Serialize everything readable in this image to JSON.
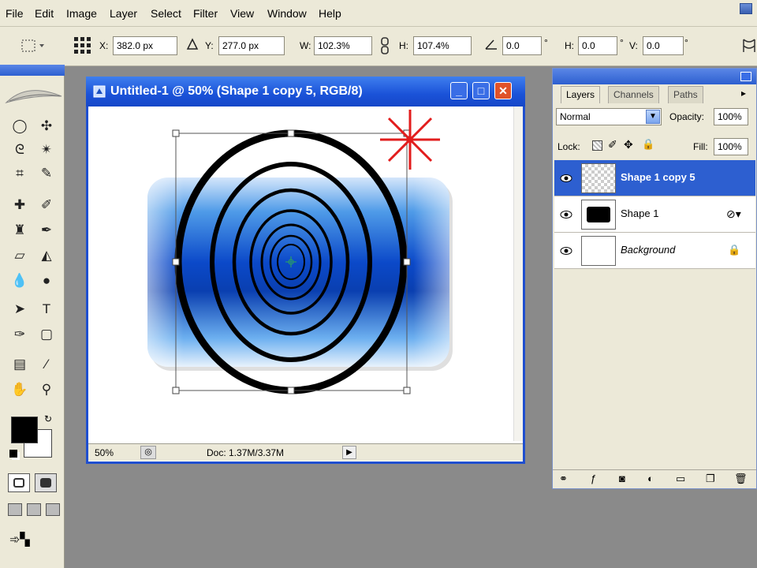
{
  "menu": [
    "File",
    "Edit",
    "Image",
    "Layer",
    "Select",
    "Filter",
    "View",
    "Window",
    "Help"
  ],
  "options": {
    "x_label": "X:",
    "x_value": "382.0 px",
    "y_label": "Y:",
    "y_value": "277.0 px",
    "w_label": "W:",
    "w_value": "102.3%",
    "h_label": "H:",
    "h_value": "107.4%",
    "rot_value": "0.0",
    "hskew_label": "H:",
    "hskew_value": "0.0",
    "vskew_label": "V:",
    "vskew_value": "0.0",
    "deg_symbol": "°"
  },
  "document": {
    "title": "Untitled-1 @ 50% (Shape 1 copy 5, RGB/8)",
    "zoom": "50%",
    "doc_info": "Doc: 1.37M/3.37M"
  },
  "layers_panel": {
    "tabs": [
      "Layers",
      "Channels",
      "Paths"
    ],
    "blend_mode": "Normal",
    "opacity_label": "Opacity:",
    "opacity_value": "100%",
    "lock_label": "Lock:",
    "fill_label": "Fill:",
    "fill_value": "100%",
    "layers": [
      {
        "name": "Shape 1 copy 5",
        "selected": true
      },
      {
        "name": "Shape 1",
        "selected": false
      },
      {
        "name": "Background",
        "selected": false,
        "locked": true
      }
    ]
  },
  "colors": {
    "xp_blue": "#1f4fcf",
    "selection_blue": "#2d5fd0",
    "panel_bg": "#ece9d8",
    "canvas_accent": "#1560d8",
    "red_star": "#e21d1d"
  }
}
